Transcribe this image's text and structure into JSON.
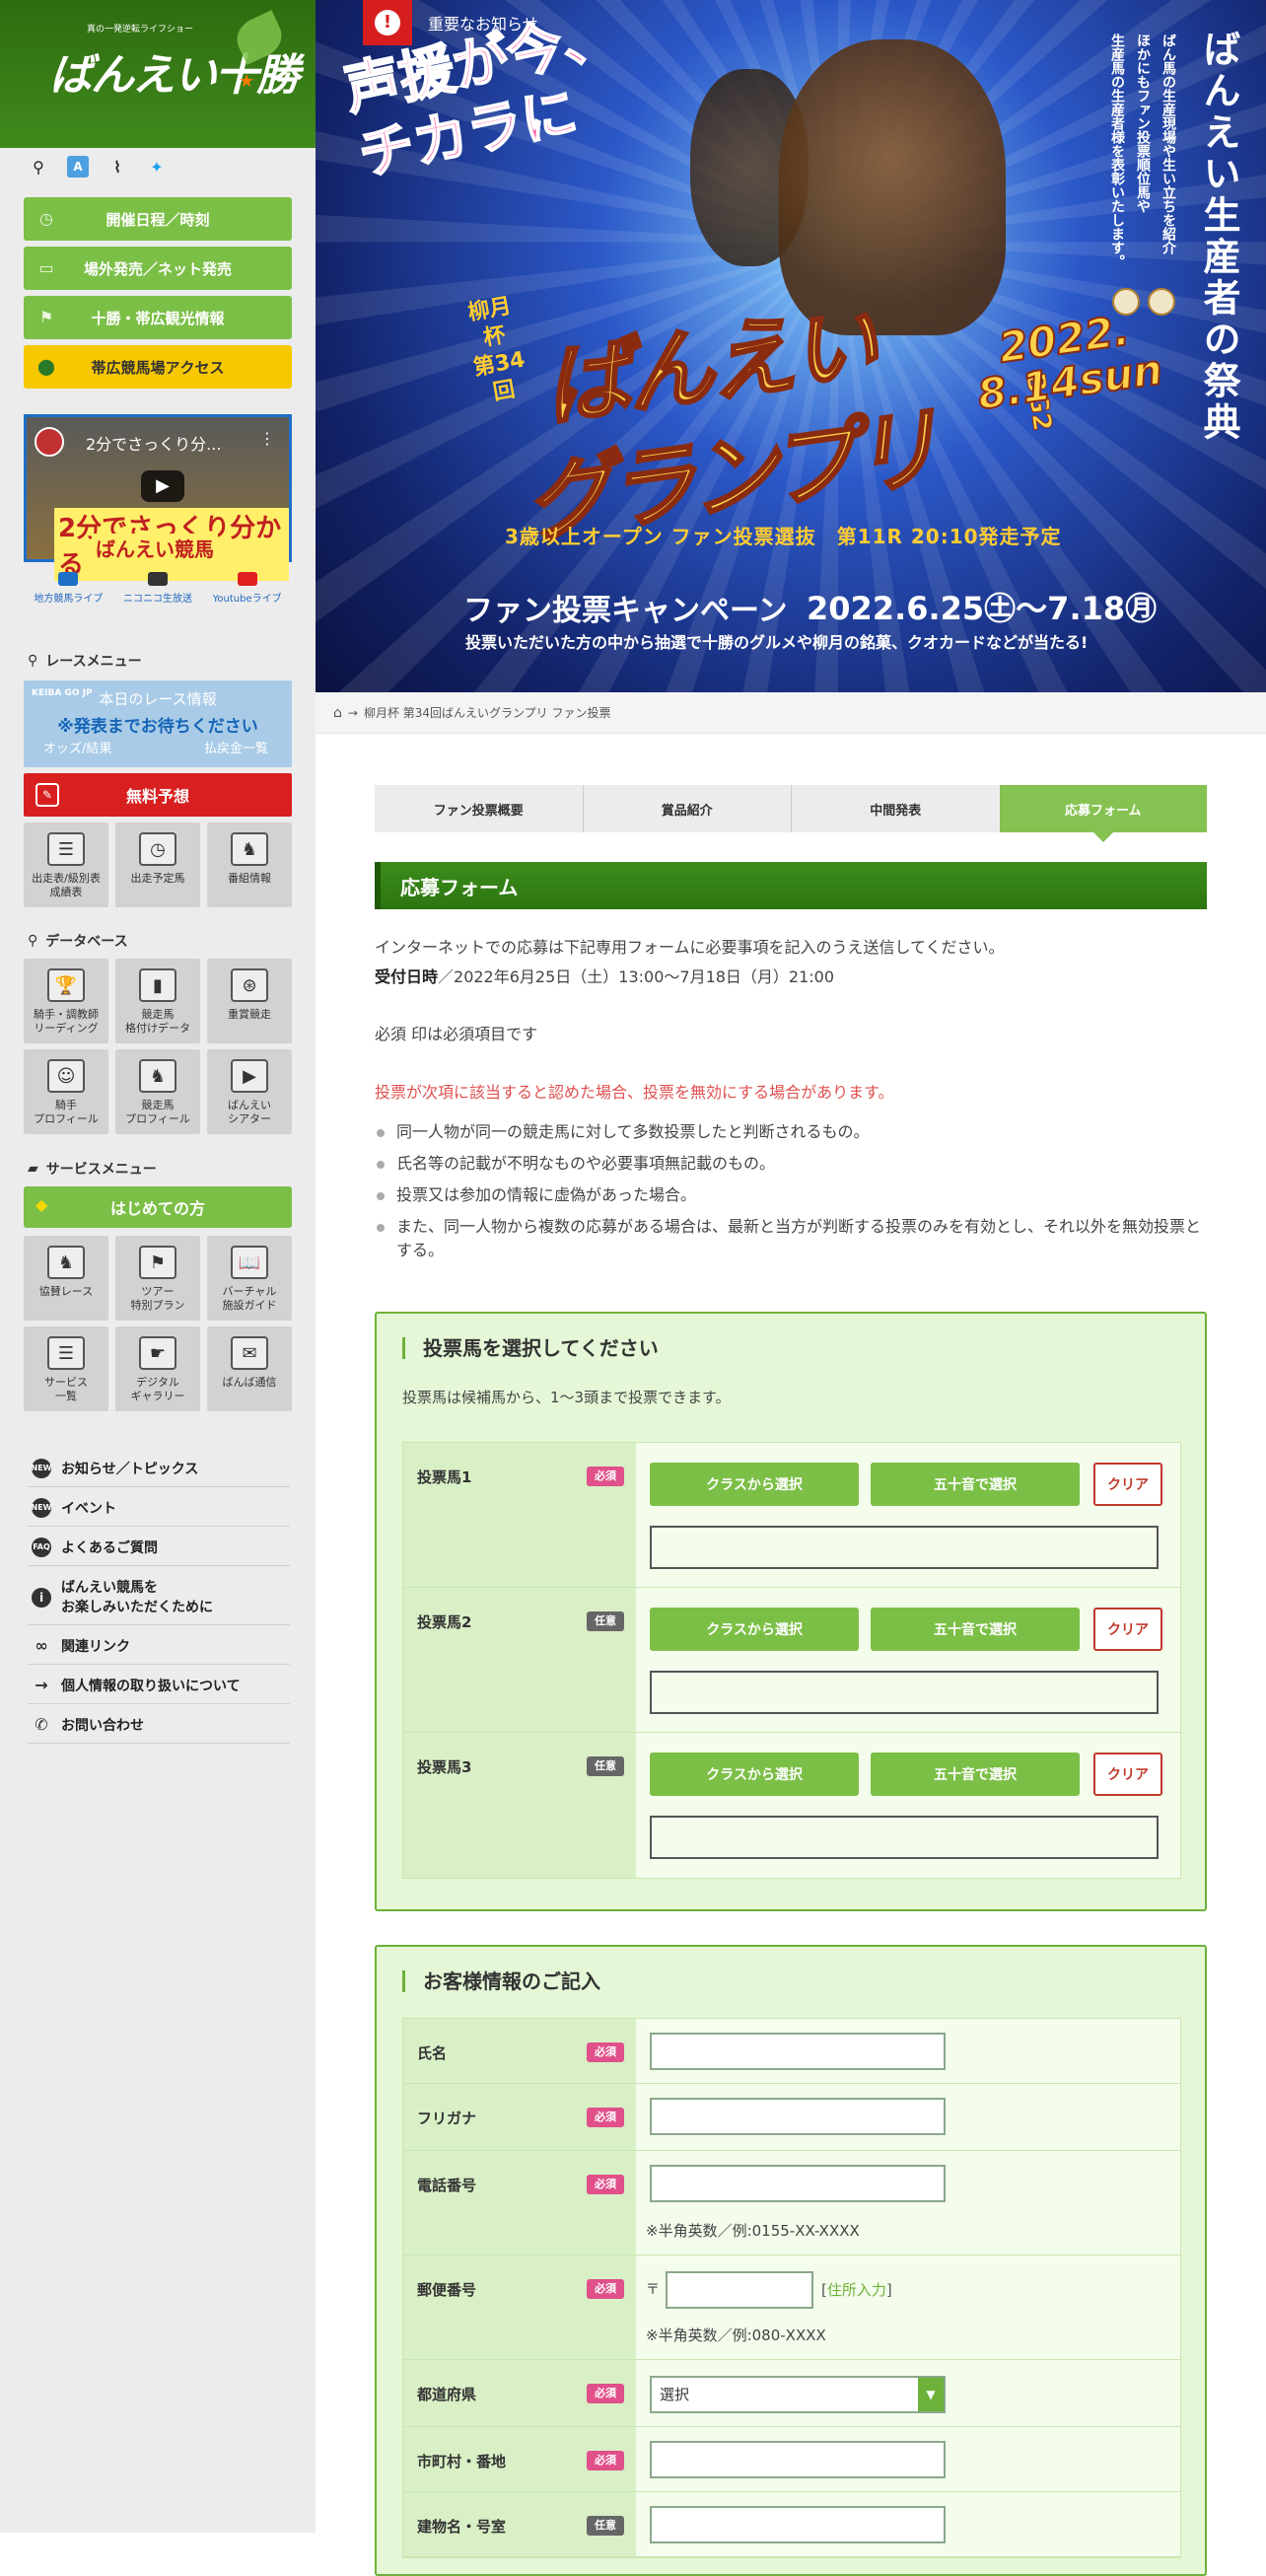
{
  "logo": {
    "subtitle": "真の一発逆転ライフショー",
    "text": "ばんえい十勝"
  },
  "icon_row": [
    {
      "name": "search-icon",
      "glyph": "⚲"
    },
    {
      "name": "translate-icon",
      "glyph": "A"
    },
    {
      "name": "rss-icon",
      "glyph": "⌇"
    },
    {
      "name": "twitter-icon",
      "glyph": "✦"
    }
  ],
  "sidebar_buttons": [
    {
      "label": "開催日程／時刻",
      "icon": "clock-icon",
      "glyph": "◷",
      "style": "green"
    },
    {
      "label": "場外発売／ネット発売",
      "icon": "ticket-icon",
      "glyph": "▭",
      "style": "green"
    },
    {
      "label": "十勝・帯広観光情報",
      "icon": "signpost-icon",
      "glyph": "⚑",
      "style": "green"
    },
    {
      "label": "帯広競馬場アクセス",
      "icon": "map-pin-icon",
      "glyph": "⬤",
      "style": "yellow"
    }
  ],
  "video": {
    "title": "2分でさっくり分...",
    "caption1": "2分でさっくり分かる",
    "caption2": "ばんえい競馬"
  },
  "live_links": [
    {
      "label": "地方競馬ライブ",
      "color": "#1e6fc7"
    },
    {
      "label": "ニコニコ生放送",
      "color": "#333333"
    },
    {
      "label": "Youtubeライブ",
      "color": "#e02020"
    }
  ],
  "race_menu": {
    "title": "レースメニュー",
    "info_keiba": "KEIBA GO JP",
    "info_title": "本日のレース情報",
    "info_status": "※発表までお待ちください",
    "info_link_left": "オッズ/結果",
    "info_link_right": "払戻金一覧",
    "free_prediction": "無料予想",
    "tiles": [
      {
        "label": "出走表/級別表\n成績表",
        "icon": "race-card-icon",
        "glyph": "☰"
      },
      {
        "label": "出走予定馬",
        "icon": "schedule-icon",
        "glyph": "◷"
      },
      {
        "label": "番組情報",
        "icon": "program-icon",
        "glyph": "♞"
      }
    ]
  },
  "database": {
    "title": "データベース",
    "tiles": [
      {
        "label": "騎手・調教師\nリーディング",
        "icon": "trophy-icon",
        "glyph": "🏆"
      },
      {
        "label": "競走馬\n格付けデータ",
        "icon": "bar-chart-icon",
        "glyph": "▮"
      },
      {
        "label": "重賞競走",
        "icon": "medal-icon",
        "glyph": "⊛"
      },
      {
        "label": "騎手\nプロフィール",
        "icon": "jockey-icon",
        "glyph": "☺"
      },
      {
        "label": "競走馬\nプロフィール",
        "icon": "horse-icon",
        "glyph": "♞"
      },
      {
        "label": "ばんえい\nシアター",
        "icon": "theater-icon",
        "glyph": "▶"
      }
    ]
  },
  "service_menu": {
    "title": "サービスメニュー",
    "first_time": "はじめての方",
    "tiles": [
      {
        "label": "協賛レース",
        "icon": "sponsor-race-icon",
        "glyph": "♞"
      },
      {
        "label": "ツアー\n特別プラン",
        "icon": "flag-icon",
        "glyph": "⚑"
      },
      {
        "label": "バーチャル\n施設ガイド",
        "icon": "book-icon",
        "glyph": "📖"
      },
      {
        "label": "サービス\n一覧",
        "icon": "list-icon",
        "glyph": "☰"
      },
      {
        "label": "デジタル\nギャラリー",
        "icon": "gallery-icon",
        "glyph": "☛"
      },
      {
        "label": "ばんば通信",
        "icon": "newsletter-icon",
        "glyph": "✉"
      }
    ]
  },
  "links": [
    {
      "label": "お知らせ／トピックス",
      "icon": "new-icon",
      "glyph": "NEW"
    },
    {
      "label": "イベント",
      "icon": "new-icon",
      "glyph": "NEW"
    },
    {
      "label": "よくあるご質問",
      "icon": "faq-icon",
      "glyph": "FAQ"
    },
    {
      "label": "ばんえい競馬を\nお楽しみいただくために",
      "icon": "info-icon",
      "glyph": "i"
    },
    {
      "label": "関連リンク",
      "icon": "link-icon",
      "glyph": "∞"
    },
    {
      "label": "個人情報の取り扱いについて",
      "icon": "arrow-right-icon",
      "glyph": "→"
    },
    {
      "label": "お問い合わせ",
      "icon": "phone-icon",
      "glyph": "✆"
    }
  ],
  "banner": {
    "notice": "重要なお知らせ",
    "slogan": "声援が今、\nチカラに",
    "vertical_title": "ばんえい生産者の祭典",
    "vertical_sub": "ばん馬の生産現場や生い立ちを紹介\nほかにもファン投票順位馬や\n生産馬の生産者様を表彰いたします。",
    "sub_title": "柳月杯\n第34回",
    "title1": "ばんえい",
    "title2": "グランプリ",
    "grade": "BG2",
    "date": "2022.\n8.14sun",
    "race_info": "3歳以上オープン ファン投票選抜　第11R 20:10発走予定",
    "campaign": "ファン投票キャンペーン",
    "campaign_date": "2022.6.25㊏〜7.18㊊",
    "lead": "投票いただいた方の中から抽選で十勝のグルメや柳月の銘菓、クオカードなどが当たる!"
  },
  "breadcrumb": {
    "separator": "→",
    "current": "柳月杯 第34回ばんえいグランプリ ファン投票"
  },
  "tabs": [
    {
      "label": "ファン投票概要",
      "active": false
    },
    {
      "label": "賞品紹介",
      "active": false
    },
    {
      "label": "中間発表",
      "active": false
    },
    {
      "label": "応募フォーム",
      "active": true
    }
  ],
  "form": {
    "heading": "応募フォーム",
    "intro": "インターネットでの応募は下記専用フォームに必要事項を記入のうえ送信してください。",
    "period_label": "受付日時",
    "period_value": "／2022年6月25日（土）13:00～7月18日（月）21:00",
    "required_note": "必須 印は必須項目です",
    "warning": "投票が次項に該当すると認めた場合、投票を無効にする場合があります。",
    "rules": [
      "同一人物が同一の競走馬に対して多数投票したと判断されるもの。",
      "氏名等の記載が不明なものや必要事項無記載のもの。",
      "投票又は参加の情報に虚偽があった場合。",
      "また、同一人物から複数の応募がある場合は、最新と当方が判断する投票のみを有効とし、それ以外を無効投票とする。"
    ]
  },
  "vote_box": {
    "title": "投票馬を選択してください",
    "subtitle": "投票馬は候補馬から、1～3頭まで投票できます。",
    "class_button": "クラスから選択",
    "kana_button": "五十音で選択",
    "clear_button": "クリア",
    "rows": [
      {
        "label": "投票馬1",
        "badge": "必須",
        "required": true
      },
      {
        "label": "投票馬2",
        "badge": "任意",
        "required": false
      },
      {
        "label": "投票馬3",
        "badge": "任意",
        "required": false
      }
    ]
  },
  "customer_box": {
    "title": "お客様情報のご記入",
    "rows": [
      {
        "label": "氏名",
        "badge": "必須"
      },
      {
        "label": "フリガナ",
        "badge": "必須"
      },
      {
        "label": "電話番号",
        "badge": "必須",
        "note": "※半角英数／例:0155-XX-XXXX"
      },
      {
        "label": "郵便番号",
        "badge": "必須",
        "zip_mark": "〒",
        "zip_link": "住所入力",
        "note": "※半角英数／例:080-XXXX"
      },
      {
        "label": "都道府県",
        "badge": "必須",
        "select_value": "選択"
      },
      {
        "label": "市町村・番地",
        "badge": "必須"
      },
      {
        "label": "建物名・号室",
        "badge": "任意"
      }
    ]
  },
  "colors": {
    "brand_green": "#7cbf47",
    "dark_green": "#2c7610",
    "required_pink": "#e0508a",
    "warning_red": "#e05050",
    "highlight_yellow": "#f7c800"
  }
}
